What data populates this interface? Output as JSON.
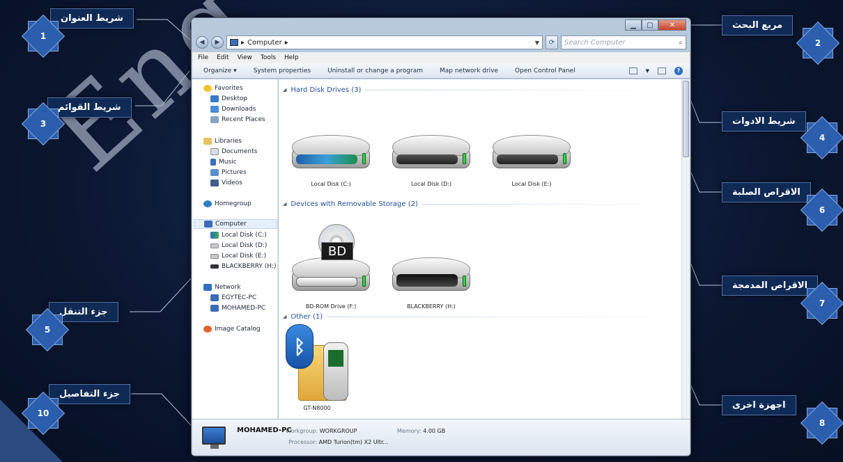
{
  "watermark": "Eng",
  "callouts": [
    {
      "num": "1",
      "label": "شريط العنوان"
    },
    {
      "num": "2",
      "label": "مربع البحث"
    },
    {
      "num": "3",
      "label": "شريط القوائم"
    },
    {
      "num": "4",
      "label": "شريط الادوات"
    },
    {
      "num": "5",
      "label": "جزء التنقل"
    },
    {
      "num": "6",
      "label": "الاقراص الصلبة"
    },
    {
      "num": "7",
      "label": "الاقراص المدمجة"
    },
    {
      "num": "8",
      "label": "اجهزة اخرى"
    },
    {
      "num": "10",
      "label": "جزء التفاصيل"
    }
  ],
  "window": {
    "address": {
      "root_arrow": "▸",
      "location": "Computer",
      "trail_arrow": "▸"
    },
    "search_placeholder": "Search Computer",
    "menu": [
      "File",
      "Edit",
      "View",
      "Tools",
      "Help"
    ],
    "toolbar": [
      "Organize ▾",
      "System properties",
      "Uninstall or change a program",
      "Map network drive",
      "Open Control Panel"
    ],
    "nav": {
      "favorites": "Favorites",
      "desktop": "Desktop",
      "downloads": "Downloads",
      "recent": "Recent Places",
      "libraries": "Libraries",
      "documents": "Documents",
      "music": "Music",
      "pictures": "Pictures",
      "videos": "Videos",
      "homegroup": "Homegroup",
      "computer": "Computer",
      "disk_c": "Local Disk (C:)",
      "disk_d": "Local Disk (D:)",
      "disk_e": "Local Disk (E:)",
      "blackberry": "BLACKBERRY (H:)",
      "network": "Network",
      "pc1": "EGYTEC-PC",
      "pc2": "MOHAMED-PC",
      "catalog": "Image Catalog"
    },
    "groups": {
      "hdd": "Hard Disk Drives (3)",
      "removable": "Devices with Removable Storage (2)",
      "other": "Other (1)"
    },
    "drives": {
      "c": "Local Disk (C:)",
      "d": "Local Disk (D:)",
      "e": "Local Disk (E:)",
      "bd": "BD-ROM Drive (F:)",
      "bb": "BLACKBERRY (H:)",
      "phone": "GT-N8000",
      "bd_tag": "BD"
    },
    "details": {
      "name": "MOHAMED-PC",
      "workgroup_label": "Workgroup:",
      "workgroup": "WORKGROUP",
      "memory_label": "Memory:",
      "memory": "4.00 GB",
      "processor_label": "Processor:",
      "processor": "AMD Turion(tm) X2 Ultr..."
    }
  }
}
